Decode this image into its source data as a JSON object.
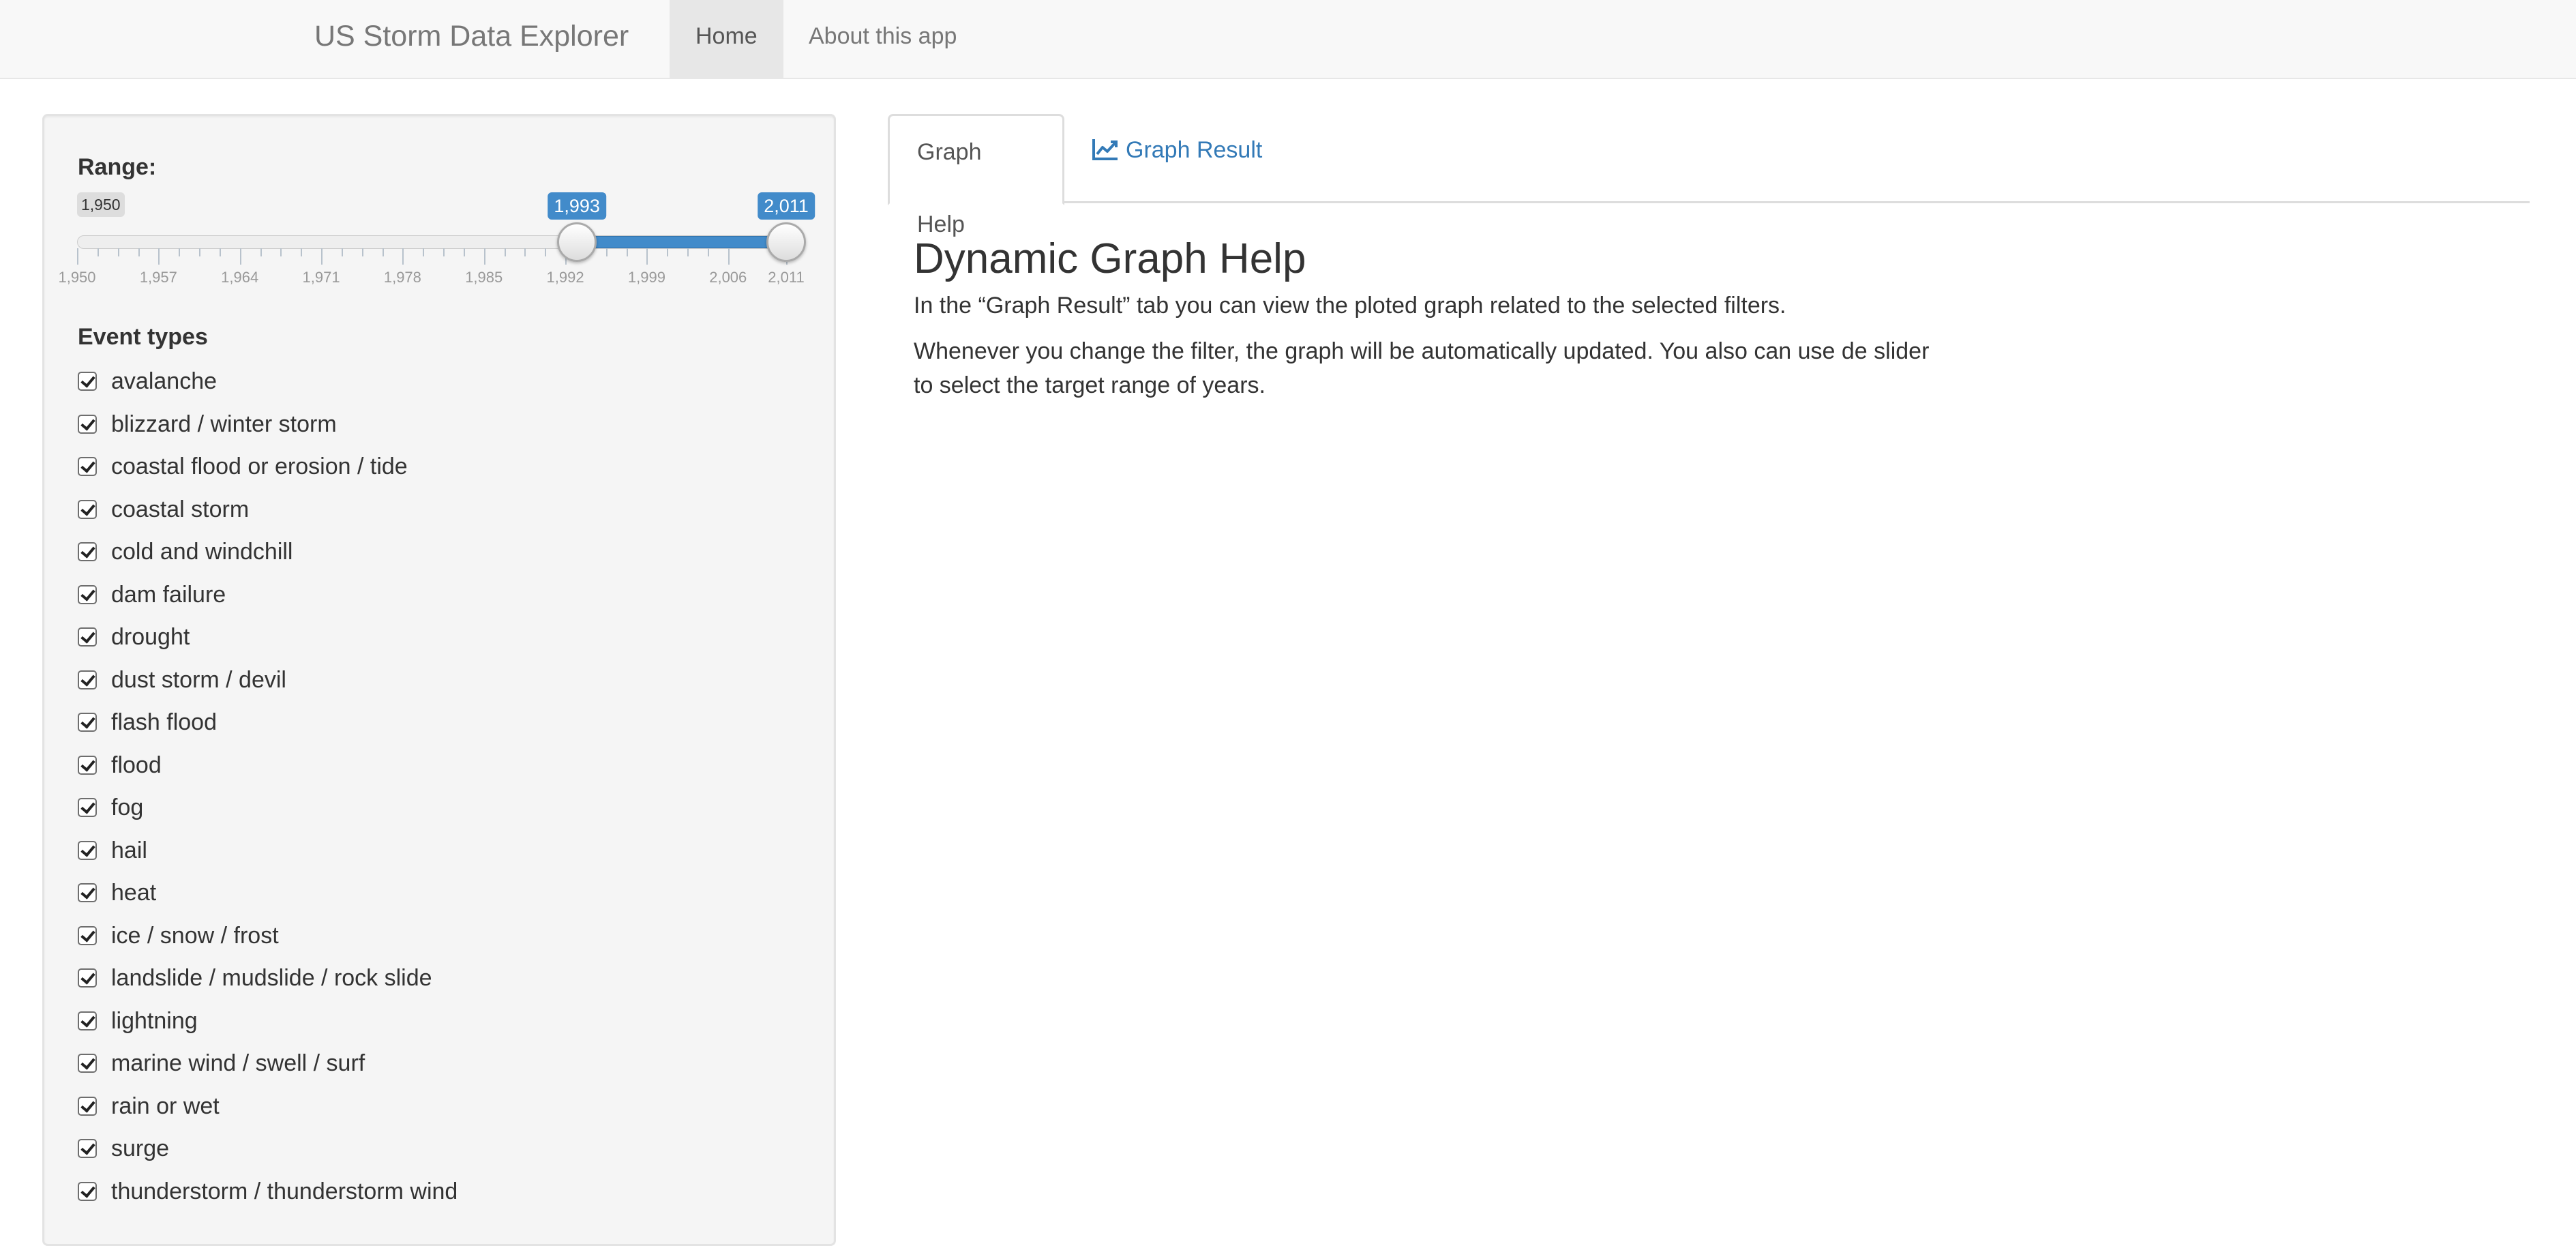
{
  "navbar": {
    "brand": "US Storm Data Explorer",
    "items": [
      {
        "label": "Home",
        "active": true
      },
      {
        "label": "About this app",
        "active": false
      }
    ]
  },
  "sidebar": {
    "range": {
      "label": "Range:",
      "min": 1950,
      "max": 2011,
      "min_label": "1,950",
      "from": 1993,
      "to": 2011,
      "from_label": "1,993",
      "to_label": "2,011",
      "ticks": [
        "1,950",
        "1,957",
        "1,964",
        "1,971",
        "1,978",
        "1,985",
        "1,992",
        "1,999",
        "2,006",
        "2,011"
      ]
    },
    "event_types": {
      "label": "Event types",
      "items": [
        {
          "label": "avalanche",
          "checked": true
        },
        {
          "label": "blizzard / winter storm",
          "checked": true
        },
        {
          "label": "coastal flood or erosion / tide",
          "checked": true
        },
        {
          "label": "coastal storm",
          "checked": true
        },
        {
          "label": "cold and windchill",
          "checked": true
        },
        {
          "label": "dam failure",
          "checked": true
        },
        {
          "label": "drought",
          "checked": true
        },
        {
          "label": "dust storm / devil",
          "checked": true
        },
        {
          "label": "flash flood",
          "checked": true
        },
        {
          "label": "flood",
          "checked": true
        },
        {
          "label": "fog",
          "checked": true
        },
        {
          "label": "hail",
          "checked": true
        },
        {
          "label": "heat",
          "checked": true
        },
        {
          "label": "ice / snow / frost",
          "checked": true
        },
        {
          "label": "landslide / mudslide / rock slide",
          "checked": true
        },
        {
          "label": "lightning",
          "checked": true
        },
        {
          "label": "marine wind / swell / surf",
          "checked": true
        },
        {
          "label": "rain or wet",
          "checked": true
        },
        {
          "label": "surge",
          "checked": true
        },
        {
          "label": "thunderstorm / thunderstorm wind",
          "checked": true
        }
      ]
    }
  },
  "main": {
    "tabs": [
      {
        "label": "Graph Help",
        "active": true,
        "icon": ""
      },
      {
        "label": "Graph Result",
        "active": false,
        "icon": "line-chart-icon"
      }
    ],
    "heading": "Dynamic Graph Help",
    "paragraphs": [
      "In the “Graph Result” tab you can view the ploted graph related to the selected filters.",
      "Whenever you change the filter, the graph will be automatically updated. You also can use de slider to select the target range of years."
    ]
  },
  "colors": {
    "accent": "#428bca",
    "link": "#337ab7",
    "navbar_bg": "#f8f8f8",
    "sidebar_bg": "#f5f5f5"
  }
}
